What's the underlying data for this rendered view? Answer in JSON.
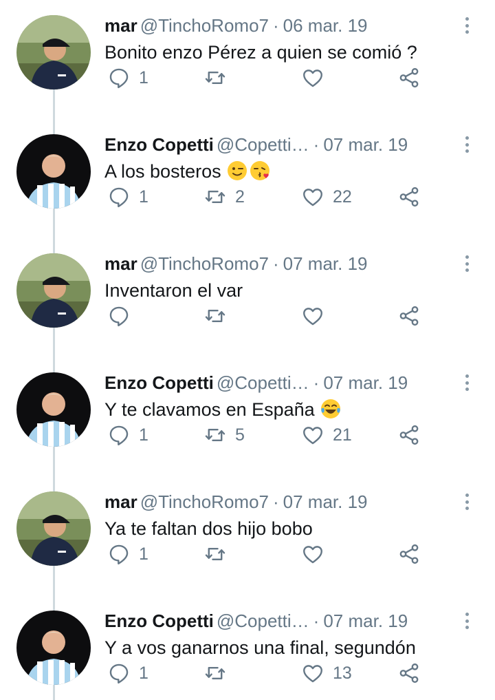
{
  "tweets": [
    {
      "author": "mar",
      "handle": "@TinchoRomo7",
      "separator": "·",
      "date": "06 mar. 19",
      "text": "Bonito enzo Pérez a quien se comió ?",
      "emojis": [],
      "replies": "1",
      "retweets": "",
      "likes": "",
      "avatar": "mar-avatar"
    },
    {
      "author": "Enzo Copetti",
      "handle": "@Copetti…",
      "separator": "·",
      "date": "07 mar. 19",
      "text": "A los bosteros",
      "emojis": [
        "winking-face-emoji",
        "kissing-face-emoji"
      ],
      "replies": "1",
      "retweets": "2",
      "likes": "22",
      "avatar": "enzo-avatar"
    },
    {
      "author": "mar",
      "handle": "@TinchoRomo7",
      "separator": "·",
      "date": "07 mar. 19",
      "text": "Inventaron el var",
      "emojis": [],
      "replies": "",
      "retweets": "",
      "likes": "",
      "avatar": "mar-avatar"
    },
    {
      "author": "Enzo Copetti",
      "handle": "@Copetti…",
      "separator": "·",
      "date": "07 mar. 19",
      "text": "Y te clavamos en España",
      "emojis": [
        "tears-of-joy-emoji"
      ],
      "replies": "1",
      "retweets": "5",
      "likes": "21",
      "avatar": "enzo-avatar"
    },
    {
      "author": "mar",
      "handle": "@TinchoRomo7",
      "separator": "·",
      "date": "07 mar. 19",
      "text": "Ya te faltan dos hijo bobo",
      "emojis": [],
      "replies": "1",
      "retweets": "",
      "likes": "",
      "avatar": "mar-avatar"
    },
    {
      "author": "Enzo Copetti",
      "handle": "@Copetti…",
      "separator": "·",
      "date": "07 mar. 19",
      "text": "Y a vos ganarnos una final, segundón",
      "emojis": [],
      "replies": "1",
      "retweets": "",
      "likes": "13",
      "avatar": "enzo-avatar"
    }
  ],
  "icons": {
    "reply": "reply-icon",
    "retweet": "retweet-icon",
    "like": "heart-icon",
    "share": "share-icon",
    "more": "more-options-icon"
  },
  "colors": {
    "text": "#14171a",
    "muted": "#657786",
    "thread_line": "#cfd9de",
    "background": "#ffffff"
  }
}
